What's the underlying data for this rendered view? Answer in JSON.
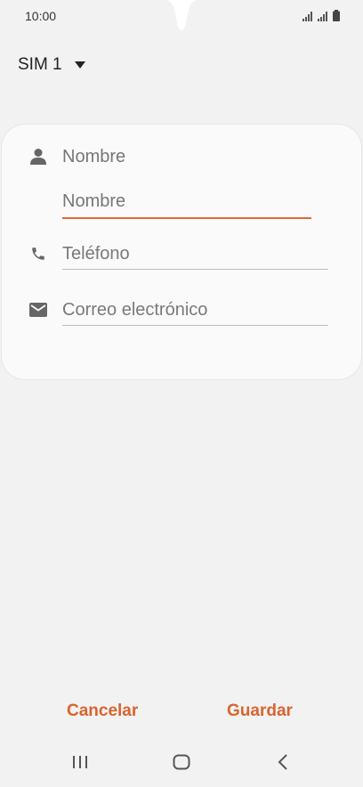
{
  "status_bar": {
    "time": "10:00"
  },
  "sim_selector": {
    "label": "SIM 1"
  },
  "form": {
    "name_label": "Nombre",
    "name_placeholder": "Nombre",
    "phone_placeholder": "Teléfono",
    "email_placeholder": "Correo electrónico"
  },
  "actions": {
    "cancel_label": "Cancelar",
    "save_label": "Guardar"
  },
  "colors": {
    "accent": "#d9642f",
    "background": "#f2f2f2",
    "card": "#fafafa"
  },
  "icons": {
    "name": "person-icon",
    "phone": "phone-icon",
    "email": "mail-icon"
  }
}
